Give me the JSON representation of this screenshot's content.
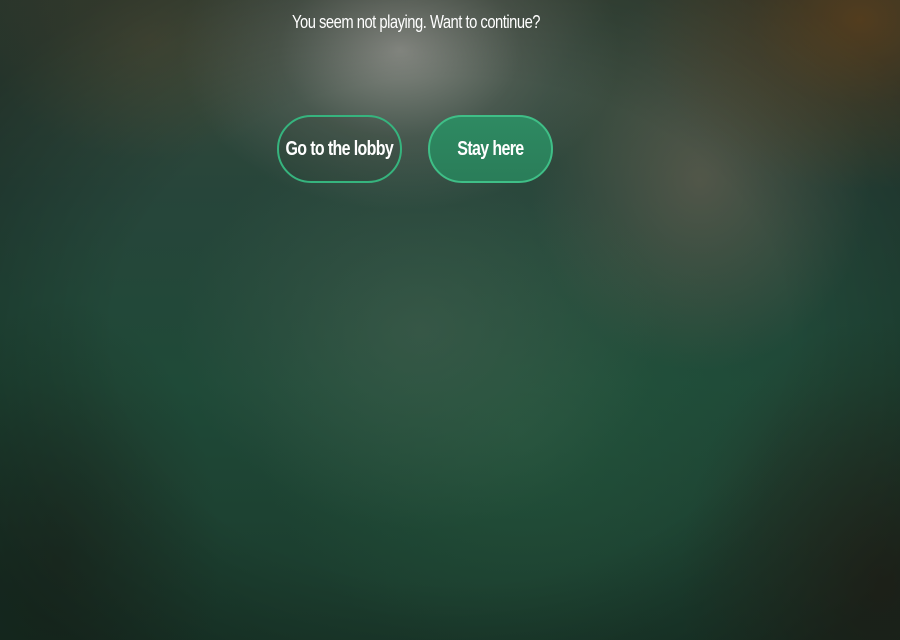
{
  "dialog": {
    "message": "You seem not playing. Want to continue?",
    "lobby_label": "Go to the lobby",
    "stay_label": "Stay here"
  },
  "colors": {
    "accent": "#36b47e",
    "primary_button": "#2a7d59",
    "text": "#ffffff"
  }
}
